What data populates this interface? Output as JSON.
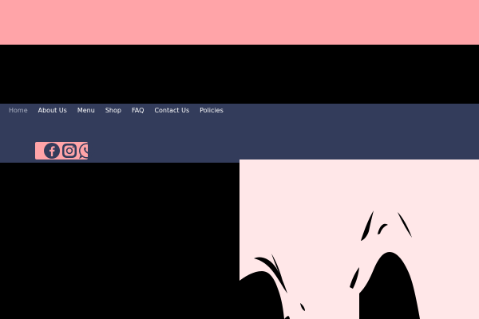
{
  "colors": {
    "top_band": "#ffa4a8",
    "nav_bg": "#333c5b",
    "social_bg": "#ffa4a8",
    "icon_fill": "#333c5b",
    "hero_bg": "#ffe7e8",
    "art_fill": "#000000"
  },
  "nav": {
    "items": [
      {
        "label": "Home",
        "active": true
      },
      {
        "label": "About Us"
      },
      {
        "label": "Menu"
      },
      {
        "label": "Shop"
      },
      {
        "label": "FAQ"
      },
      {
        "label": "Contact Us"
      },
      {
        "label": "Policies"
      }
    ]
  },
  "social": {
    "icons": [
      "facebook-icon",
      "instagram-icon",
      "whatsapp-icon"
    ]
  }
}
